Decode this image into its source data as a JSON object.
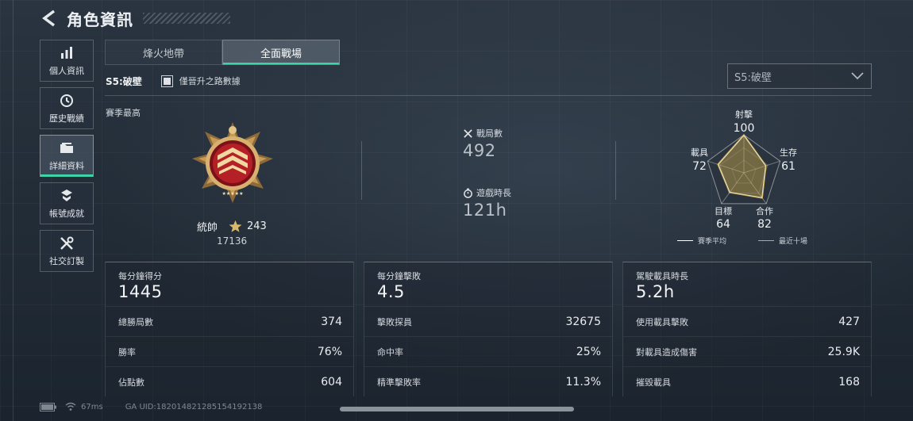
{
  "header": {
    "title": "角色資訊"
  },
  "sidebar": {
    "items": [
      {
        "label": "個人資訊",
        "icon": "bar-chart-icon",
        "active": false
      },
      {
        "label": "歷史戰績",
        "icon": "history-icon",
        "active": false
      },
      {
        "label": "詳細資料",
        "icon": "folder-icon",
        "active": true
      },
      {
        "label": "帳號成就",
        "icon": "achievement-icon",
        "active": false
      },
      {
        "label": "社交訂製",
        "icon": "tools-icon",
        "active": false
      }
    ]
  },
  "tabs": [
    {
      "label": "烽火地帶",
      "active": false
    },
    {
      "label": "全面戰場",
      "active": true
    }
  ],
  "season": {
    "name": "S5:破壁",
    "checkbox_label": "僅晉升之路數據",
    "checkbox_checked": true,
    "select_value": "S5:破壁"
  },
  "best": {
    "label": "賽季最高",
    "rank_name": "統帥",
    "stars": "243",
    "points": "17136"
  },
  "summary": {
    "matches_label": "戰局數",
    "matches_value": "492",
    "time_label": "遊戲時長",
    "time_value": "121h"
  },
  "radar": {
    "axes": [
      {
        "label": "射擊",
        "value": 100
      },
      {
        "label": "生存",
        "value": 61
      },
      {
        "label": "合作",
        "value": 82
      },
      {
        "label": "目標",
        "value": 64
      },
      {
        "label": "載具",
        "value": 72
      }
    ],
    "legend": [
      {
        "label": "賽季平均",
        "color": "#ffffff"
      },
      {
        "label": "最近十場",
        "color": "#c9a94a"
      }
    ]
  },
  "panels": [
    {
      "title": "每分鐘得分",
      "value": "1445",
      "rows": [
        {
          "label": "總勝局數",
          "value": "374"
        },
        {
          "label": "勝率",
          "value": "76%"
        },
        {
          "label": "佔點數",
          "value": "604"
        }
      ]
    },
    {
      "title": "每分鐘擊敗",
      "value": "4.5",
      "rows": [
        {
          "label": "擊敗探員",
          "value": "32675"
        },
        {
          "label": "命中率",
          "value": "25%"
        },
        {
          "label": "精準擊敗率",
          "value": "11.3%"
        }
      ]
    },
    {
      "title": "駕駛載具時長",
      "value": "5.2h",
      "rows": [
        {
          "label": "使用載具擊敗",
          "value": "427"
        },
        {
          "label": "對載具造成傷害",
          "value": "25.9K"
        },
        {
          "label": "摧毀載具",
          "value": "168"
        }
      ]
    }
  ],
  "status": {
    "ping": "67ms",
    "uid": "GA UID:182014821285154192138"
  },
  "colors": {
    "accent": "#3ed3a8",
    "gold": "#c9a94a"
  }
}
